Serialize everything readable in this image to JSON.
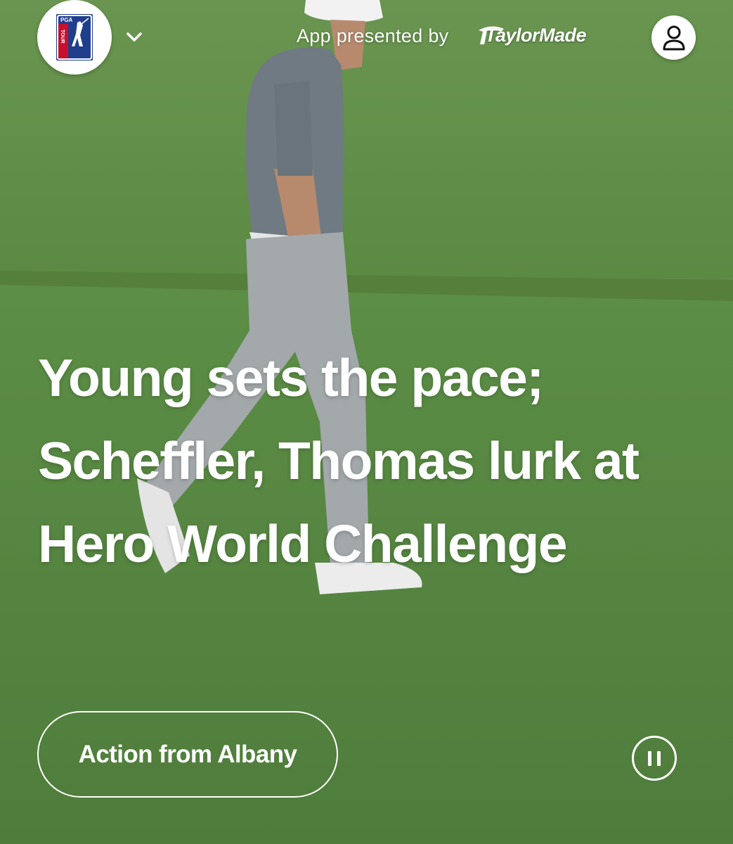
{
  "header": {
    "logo_text": [
      "PGA",
      "TOUR"
    ],
    "presented_label": "App presented by",
    "sponsor": "TaylorMade"
  },
  "story": {
    "headline": "Young sets the pace; Scheffler, Thomas lurk at Hero World Challenge",
    "action_label": "Action from Albany"
  },
  "icons": {
    "menu": "chevron-down-icon",
    "account": "user-icon",
    "media": "pause-icon"
  },
  "colors": {
    "pga_blue": "#1f3f8c",
    "pga_red": "#c8102e",
    "overlay_text": "#ffffff",
    "grass_fairway": "#5f8c48",
    "grass_green": "#4e7c3d"
  }
}
